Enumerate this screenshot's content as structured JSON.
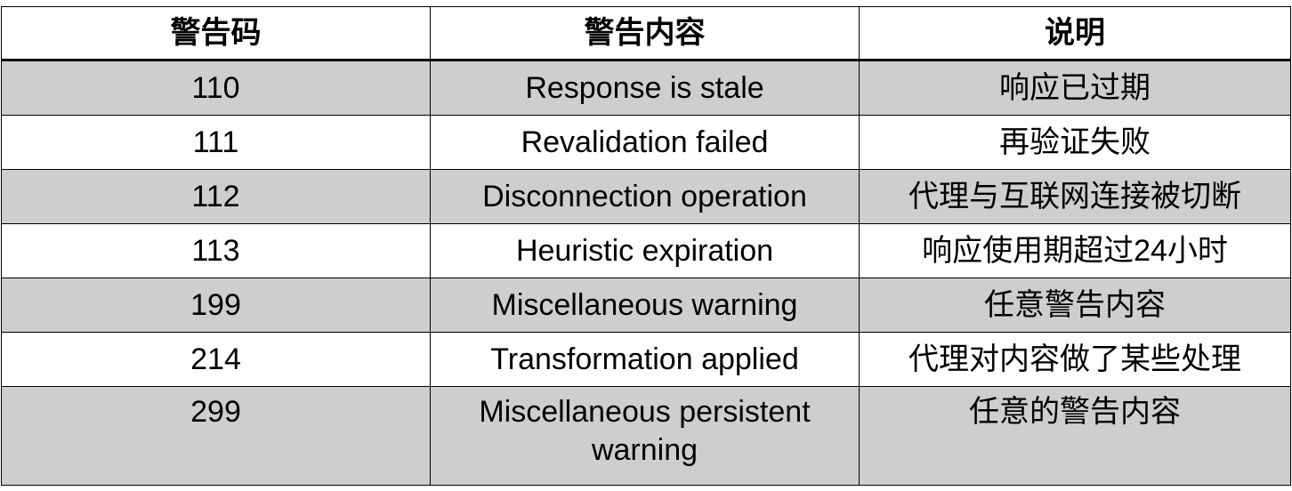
{
  "table": {
    "headers": [
      "警告码",
      "警告内容",
      "说明"
    ],
    "rows": [
      {
        "code": "110",
        "content": "Response is stale",
        "desc": "响应已过期"
      },
      {
        "code": "111",
        "content": "Revalidation failed",
        "desc": "再验证失败"
      },
      {
        "code": "112",
        "content": "Disconnection operation",
        "desc": "代理与互联网连接被切断"
      },
      {
        "code": "113",
        "content": "Heuristic expiration",
        "desc": "响应使用期超过24小时"
      },
      {
        "code": "199",
        "content": "Miscellaneous warning",
        "desc": "任意警告内容"
      },
      {
        "code": "214",
        "content": "Transformation applied",
        "desc": "代理对内容做了某些处理"
      },
      {
        "code": "299",
        "content": "Miscellaneous persistent warning",
        "desc": "任意的警告内容"
      }
    ]
  },
  "colors": {
    "shaded_row": "#cecece",
    "plain_row": "#ffffff",
    "border": "#000000"
  }
}
